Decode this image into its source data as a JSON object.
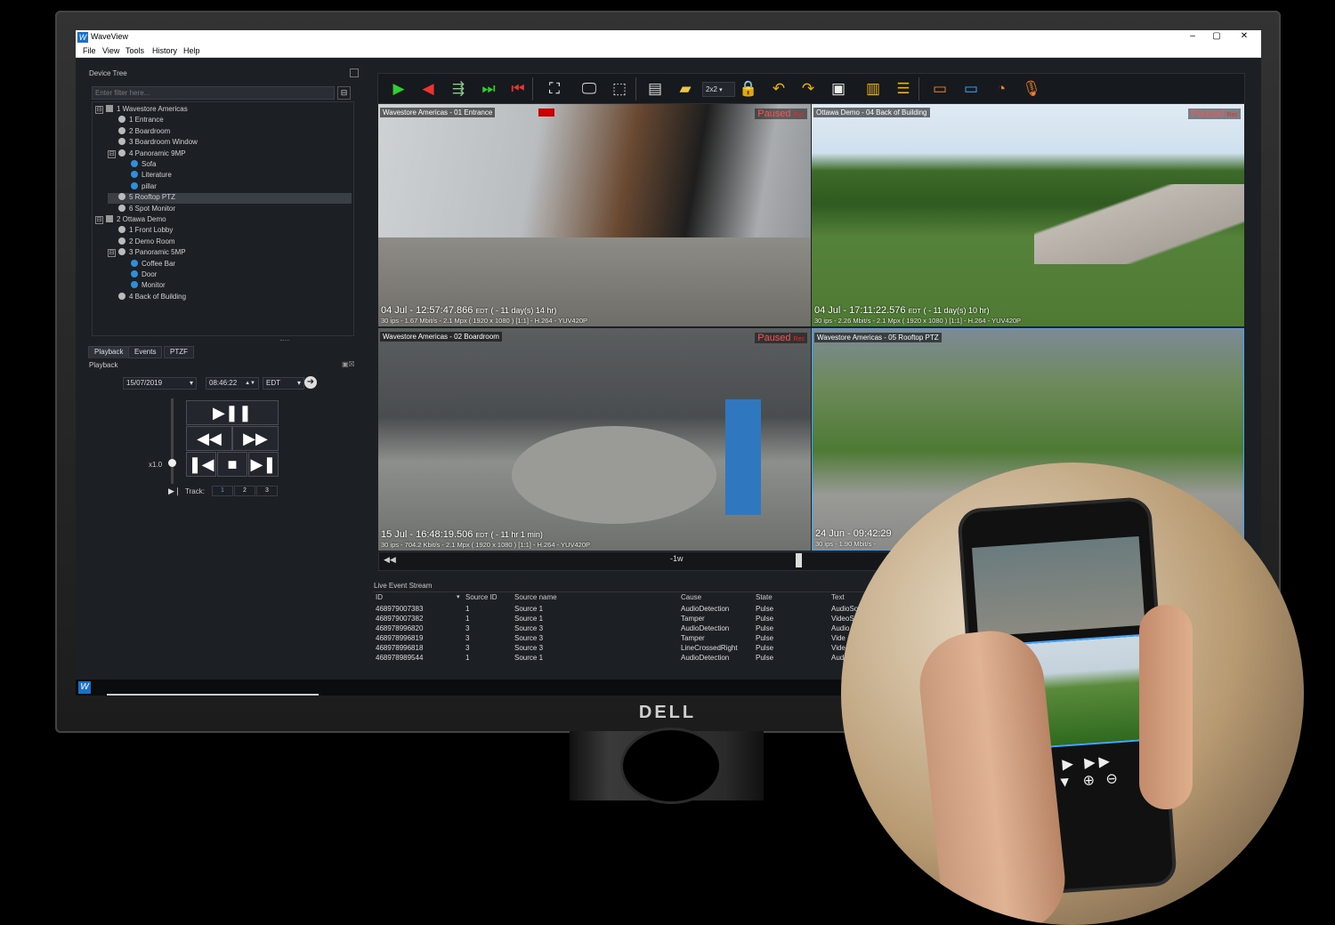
{
  "monitor_brand": "DELL",
  "app": {
    "title": "WaveView",
    "logo": "W",
    "menu": [
      "File",
      "View",
      "Tools",
      "History",
      "Help"
    ],
    "window_controls": [
      "–",
      "▢",
      "✕"
    ]
  },
  "device_tree": {
    "label": "Device Tree",
    "filter_placeholder": "Enter filter here...",
    "items": [
      {
        "label": "1 Wavestore Americas",
        "level": 0,
        "kind": "server",
        "expand": "⊟"
      },
      {
        "label": "1 Entrance",
        "level": 1,
        "kind": "device"
      },
      {
        "label": "2 Boardroom",
        "level": 1,
        "kind": "device"
      },
      {
        "label": "3 Boardroom Window",
        "level": 1,
        "kind": "device"
      },
      {
        "label": "4 Panoramic 9MP",
        "level": 1,
        "kind": "device",
        "expand": "⊟"
      },
      {
        "label": "Sofa",
        "level": 2,
        "kind": "camera"
      },
      {
        "label": "Literature",
        "level": 2,
        "kind": "camera"
      },
      {
        "label": "pillar",
        "level": 2,
        "kind": "camera"
      },
      {
        "label": "5 Rooftop PTZ",
        "level": 1,
        "kind": "device",
        "selected": true
      },
      {
        "label": "6 Spot Monitor",
        "level": 1,
        "kind": "device"
      },
      {
        "label": "2 Ottawa Demo",
        "level": 0,
        "kind": "server",
        "expand": "⊟"
      },
      {
        "label": "1 Front Lobby",
        "level": 1,
        "kind": "device"
      },
      {
        "label": "2 Demo Room",
        "level": 1,
        "kind": "device"
      },
      {
        "label": "3 Panoramic 5MP",
        "level": 1,
        "kind": "device",
        "expand": "⊟"
      },
      {
        "label": "Coffee Bar",
        "level": 2,
        "kind": "camera"
      },
      {
        "label": "Door",
        "level": 2,
        "kind": "camera"
      },
      {
        "label": "Monitor",
        "level": 2,
        "kind": "camera"
      },
      {
        "label": "4 Back of Building",
        "level": 1,
        "kind": "device"
      }
    ]
  },
  "playback": {
    "tabs": [
      "Playback",
      "Events",
      "PTZF"
    ],
    "section_label": "Playback",
    "date": "15/07/2019",
    "time": "08:46:22",
    "timezone": "EDT",
    "speed": "x1.0",
    "track_label": "Track:",
    "tracks": [
      "1",
      "2",
      "3"
    ],
    "buttons": [
      "▶❚❚",
      "◀◀",
      "▶▶",
      "❚◀",
      "■",
      "▶❚"
    ]
  },
  "toolbar": {
    "layout_value": "2x2"
  },
  "tiles": [
    {
      "title": "Wavestore Americas - 01 Entrance",
      "status": "Paused",
      "rec": "Rec",
      "timestamp": "04 Jul - 12:57:47.866",
      "tz": "EDT",
      "age": "( - 11 day(s) 14 hr)",
      "info": "30 ips  -  1.67 Mbit/s  -  2.1 Mpx  ( 1920 x 1080 ) [1:1]  -  H.264  -  YUV420P"
    },
    {
      "title": "Ottawa Demo - 04 Back of Building",
      "status": "Paused",
      "rec": "Rec",
      "timestamp": "04 Jul - 17:11:22.576",
      "tz": "EDT",
      "age": "( - 11 day(s) 10 hr)",
      "info": "30 ips  -  2.26 Mbit/s  -  2.1 Mpx  ( 1920 x 1080 ) [1:1]  -  H.264  -  YUV420P"
    },
    {
      "title": "Wavestore Americas - 02 Boardroom",
      "status": "Paused",
      "rec": "Rec",
      "timestamp": "15 Jul - 16:48:19.506",
      "tz": "EDT",
      "age": "( - 11 hr 1 min)",
      "info": "30 ips  -  704.2 Kbit/s  -  2.1 Mpx  ( 1920 x 1080 ) [1:1]  -  H.264  -  YUV420P"
    },
    {
      "title": "Wavestore Americas - 05 Rooftop PTZ",
      "status": "",
      "rec": "",
      "timestamp": "24 Jun - 09:42:29",
      "tz": "",
      "age": "",
      "info": "30 ips  -  1.90 Mbit/s  -"
    }
  ],
  "timeline": {
    "label": "-1w"
  },
  "events": {
    "label": "Live Event Stream",
    "columns": [
      "ID",
      "Source ID",
      "Source name",
      "Cause",
      "State",
      "Text"
    ],
    "rows": [
      [
        "468979007383",
        "1",
        "Source 1",
        "AudioDetection",
        "Pulse",
        "AudioSo"
      ],
      [
        "468979007382",
        "1",
        "Source 1",
        "Tamper",
        "Pulse",
        "VideoS"
      ],
      [
        "468978996820",
        "3",
        "Source 3",
        "AudioDetection",
        "Pulse",
        "Audio"
      ],
      [
        "468978996819",
        "3",
        "Source 3",
        "Tamper",
        "Pulse",
        "Vide"
      ],
      [
        "468978996818",
        "3",
        "Source 3",
        "LineCrossedRight",
        "Pulse",
        "Vide"
      ],
      [
        "468978989544",
        "1",
        "Source 1",
        "AudioDetection",
        "Pulse",
        "Aud"
      ]
    ]
  },
  "colors": {
    "accent": "#2f8fd8",
    "paused": "#ff5050",
    "panel": "#1c1f24"
  }
}
